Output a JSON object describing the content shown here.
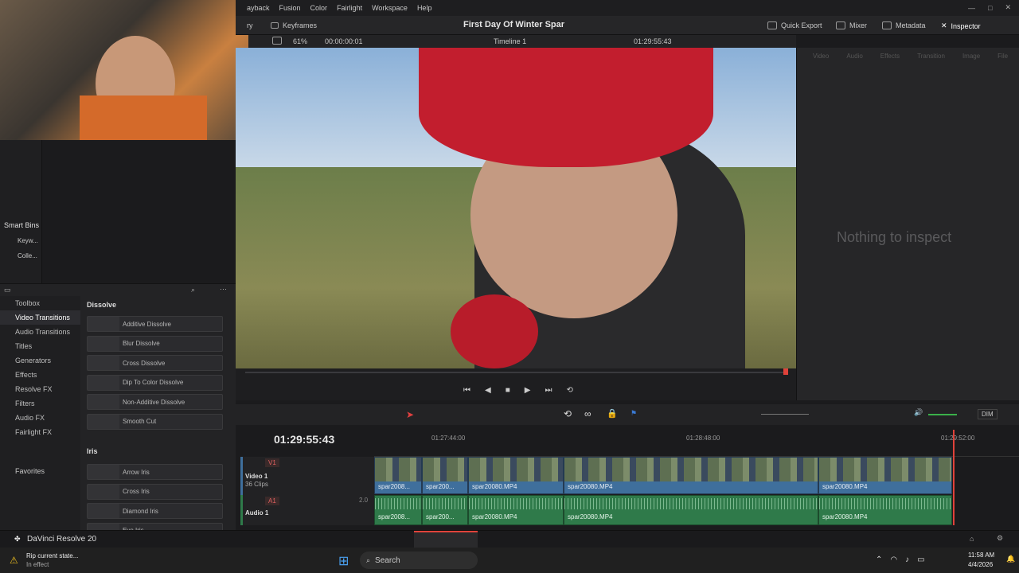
{
  "menubar": {
    "items": [
      "ayback",
      "Fusion",
      "Color",
      "Fairlight",
      "Workspace",
      "Help"
    ]
  },
  "toolbar": {
    "left_item": "ry",
    "keyframes": "Keyframes",
    "project_title": "First Day Of Winter Spar",
    "quick_export": "Quick Export",
    "mixer": "Mixer",
    "metadata": "Metadata",
    "inspector": "Inspector"
  },
  "viewer": {
    "zoom": "61%",
    "timecode_left": "00:00:00:01",
    "timeline_name": "Timeline 1",
    "timecode_right": "01:29:55:43"
  },
  "inspector": {
    "tabs": [
      "Video",
      "Audio",
      "Effects",
      "Transition",
      "Image",
      "File"
    ],
    "empty_message": "Nothing to inspect"
  },
  "left_panel": {
    "smart_bins": "Smart Bins",
    "bins": [
      "Keyw...",
      "Colle..."
    ],
    "tree": [
      {
        "label": "Toolbox",
        "selected": false
      },
      {
        "label": "Video Transitions",
        "selected": true
      },
      {
        "label": "Audio Transitions",
        "selected": false
      },
      {
        "label": "Titles",
        "selected": false
      },
      {
        "label": "Generators",
        "selected": false
      },
      {
        "label": "Effects",
        "selected": false
      },
      {
        "label": "Resolve FX",
        "selected": false
      },
      {
        "label": "Filters",
        "selected": false
      },
      {
        "label": "Audio FX",
        "selected": false
      },
      {
        "label": "Fairlight FX",
        "selected": false
      }
    ],
    "favorites": "Favorites",
    "dissolve_header": "Dissolve",
    "dissolve_items": [
      "Additive Dissolve",
      "Blur Dissolve",
      "Cross Dissolve",
      "Dip To Color Dissolve",
      "Non-Additive Dissolve",
      "Smooth Cut"
    ],
    "iris_header": "Iris",
    "iris_items": [
      "Arrow Iris",
      "Cross Iris",
      "Diamond Iris",
      "Eye Iris"
    ]
  },
  "timeline": {
    "timecode": "01:29:55:43",
    "ruler": [
      "01:27:44:00",
      "01:28:48:00",
      "01:29:52:00"
    ],
    "video_track": {
      "id": "V1",
      "name": "Video 1",
      "clips_count": "36 Clips"
    },
    "audio_track": {
      "id": "A1",
      "name": "Audio 1",
      "level": "2.0"
    },
    "video_clips": [
      "spar2008...",
      "spar200...",
      "spar20080.MP4",
      "spar20080.MP4",
      "spar20080.MP4"
    ],
    "audio_clips": [
      "spar2008...",
      "spar200...",
      "spar20080.MP4",
      "spar20080.MP4",
      "spar20080.MP4"
    ],
    "dim_label": "DIM"
  },
  "app": {
    "name": "DaVinci Resolve 20"
  },
  "taskbar": {
    "notification_title": "Rip current state...",
    "notification_sub": "In effect",
    "search_label": "Search",
    "time": "11:58 AM",
    "date": "4/4/2026"
  },
  "colors": {
    "accent": "#d44040",
    "video_clip": "#3f6f9c",
    "audio_clip": "#2f7a4a",
    "edit_page_marker": "#e0423a"
  }
}
